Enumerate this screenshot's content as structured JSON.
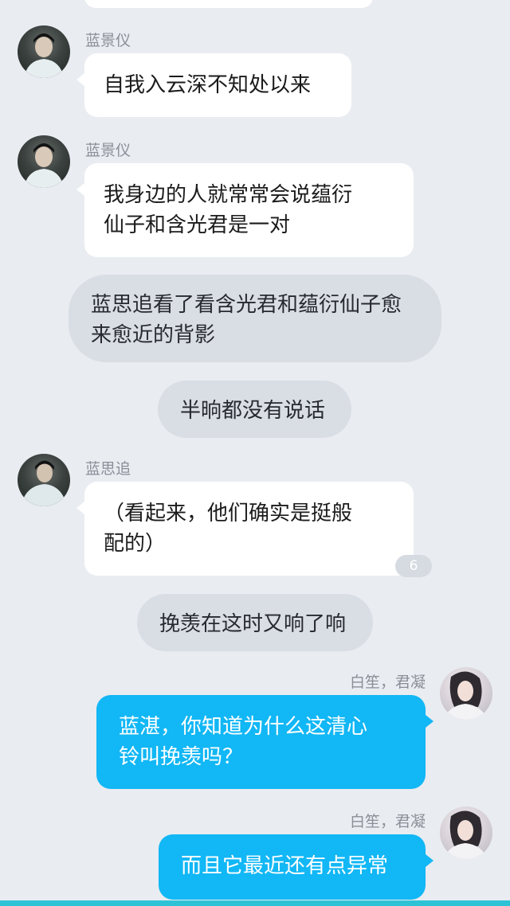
{
  "messages": [
    {
      "sender": "蓝景仪",
      "text": "自我入云深不知处以来",
      "side": "left"
    },
    {
      "sender": "蓝景仪",
      "lines": [
        "我身边的人就常常会说蕴衍",
        "仙子和含光君是一对"
      ],
      "side": "left"
    },
    {
      "type": "narration",
      "lines": [
        "蓝思追看了看含光君和蕴衍仙子愈",
        "来愈近的背影"
      ]
    },
    {
      "type": "narration",
      "lines": [
        "半晌都没有说话"
      ]
    },
    {
      "sender": "蓝思追",
      "lines": [
        "（看起来，他们确实是挺般",
        "配的）"
      ],
      "side": "left",
      "unread_count": "6"
    },
    {
      "type": "narration",
      "lines": [
        "挽羡在这时又响了响"
      ]
    },
    {
      "sender": "白笙，君凝",
      "lines": [
        "蓝湛，你知道为什么这清心",
        "铃叫挽羡吗？"
      ],
      "side": "right"
    },
    {
      "sender": "白笙，君凝",
      "lines": [
        "而且它最近还有点异常"
      ],
      "side": "right"
    }
  ],
  "colors": {
    "background": "#e9ecf1",
    "self_bubble": "#12b7f5",
    "other_bubble": "#ffffff",
    "narration_bubble": "#d9dde4",
    "bottom_bar": "#2ec2d6"
  }
}
